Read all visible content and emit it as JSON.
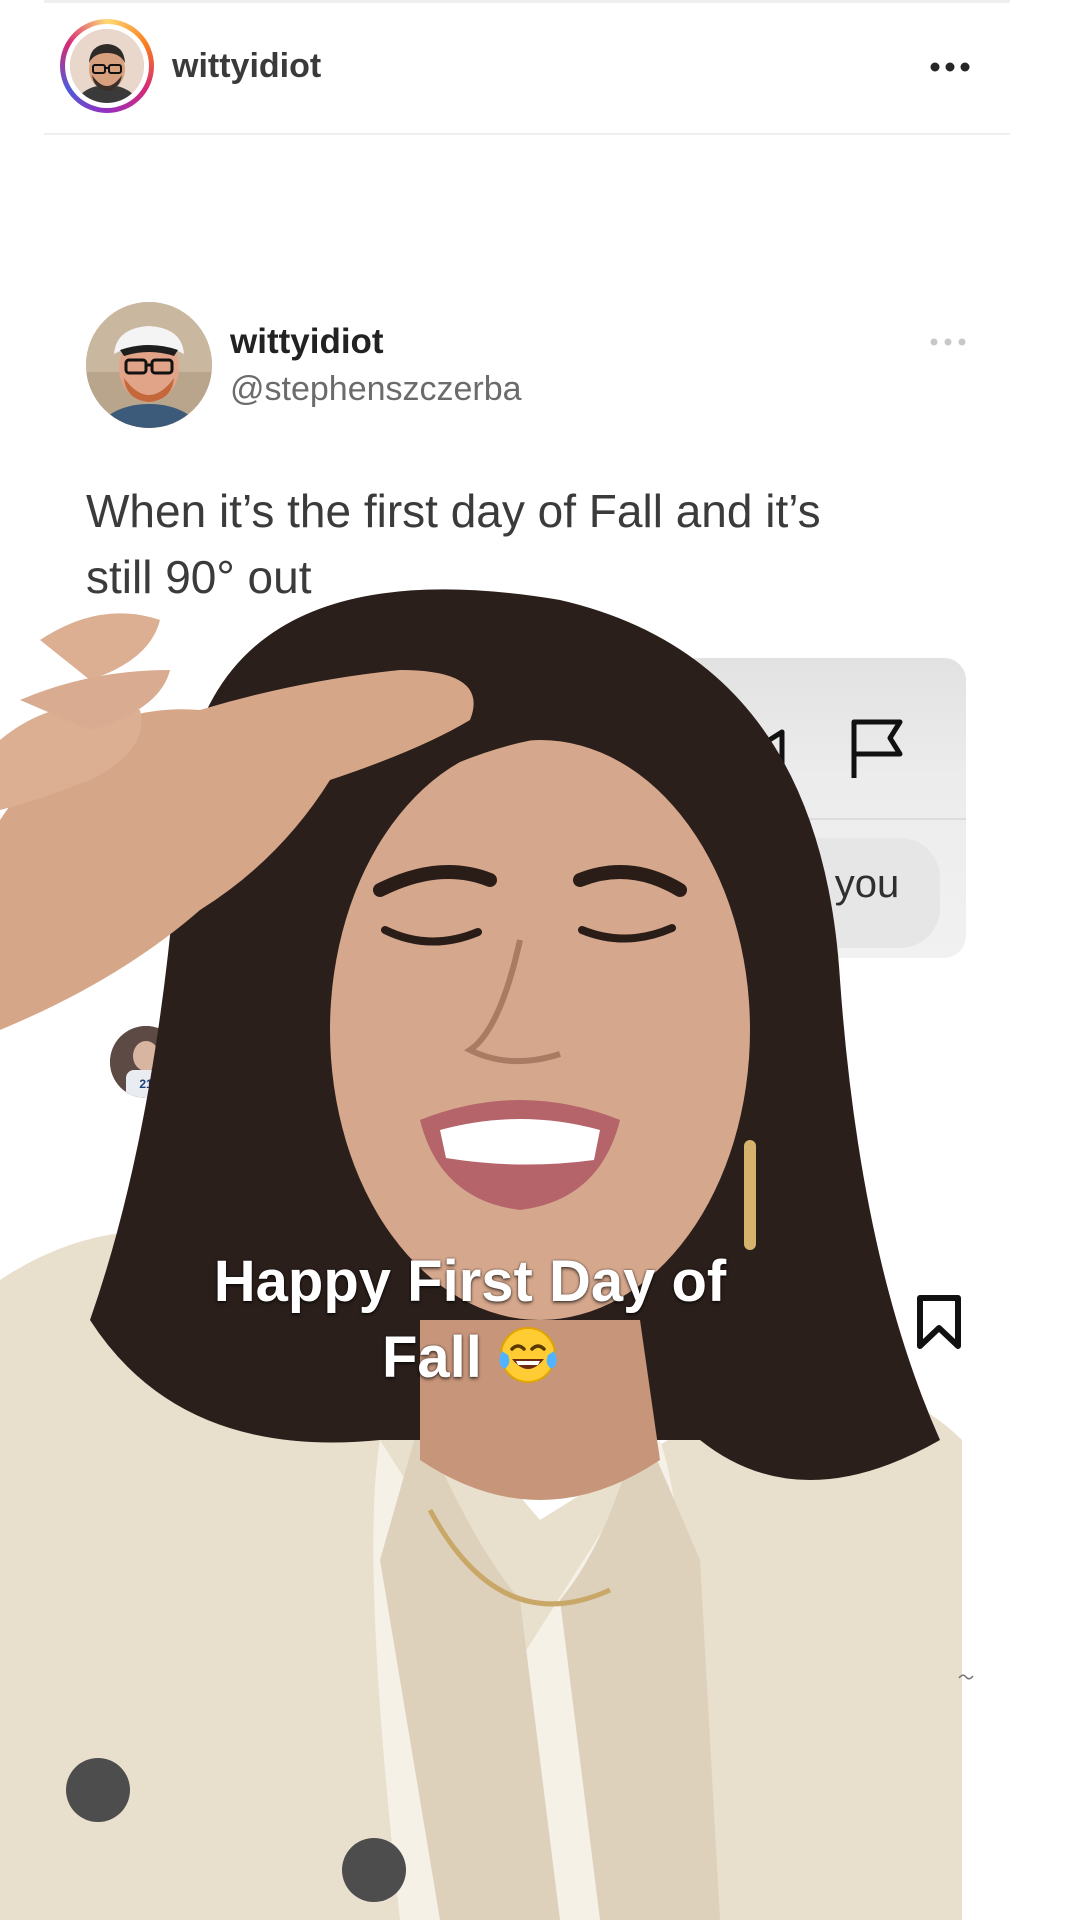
{
  "post": {
    "username": "wittyidiot",
    "more_icon": "more-horizontal-icon"
  },
  "tweet": {
    "name": "wittyidiot",
    "handle": "@stephenszczerba",
    "line1": "When it’s the first day of Fall and it’s",
    "line2": "still 90° out",
    "more_icon": "more-horizontal-icon"
  },
  "dm": {
    "bubble_text": "hot you",
    "video_icon": "video-camera-icon",
    "flag_icon": "flag-icon"
  },
  "caption": {
    "line1": "Happy First Day of",
    "line2": "Fall",
    "emoji": "face-with-tears-of-joy-emoji"
  },
  "actions": {
    "save_icon": "bookmark-icon"
  },
  "colors": {
    "text_dark": "#262626",
    "handle_gray": "#6b6b6b",
    "caption_white": "#ffffff"
  }
}
